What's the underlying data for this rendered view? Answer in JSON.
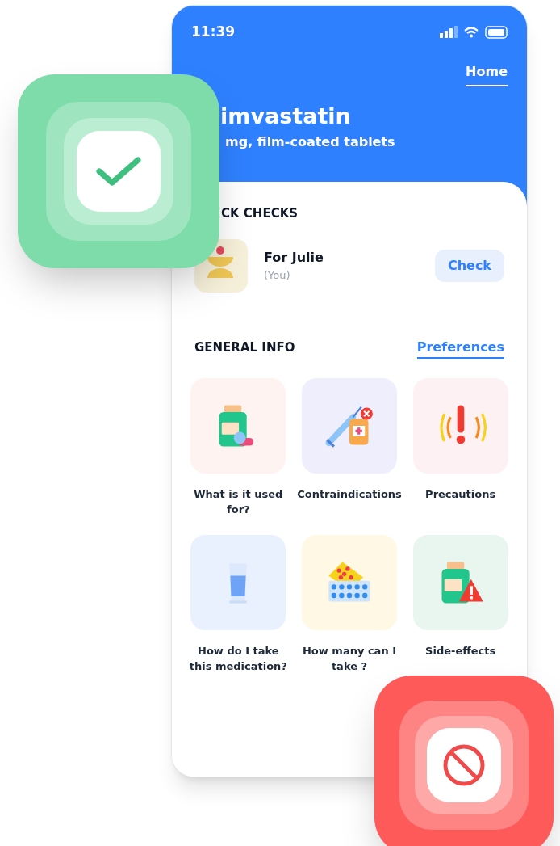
{
  "status_bar": {
    "time": "11:39"
  },
  "nav": {
    "label": "Home",
    "selected": true
  },
  "drug": {
    "name": "imvastatin",
    "description": "mg, film-coated tablets"
  },
  "quick_checks": {
    "heading": "CK CHECKS",
    "person": {
      "name": "For Julie",
      "note": "(You)"
    },
    "button": "Check"
  },
  "general_info": {
    "heading": "GENERAL INFO",
    "link": "Preferences",
    "tiles": [
      {
        "label": "What is it used for?",
        "kind": "bottle",
        "color": "#fef3f0"
      },
      {
        "label": "Contraindications",
        "kind": "syringe",
        "color": "#efeefd"
      },
      {
        "label": "Precautions",
        "kind": "alert",
        "color": "#fef1f3"
      },
      {
        "label": "How do I take this medication?",
        "kind": "glass",
        "color": "#e9f1fe"
      },
      {
        "label": "How many can I take ?",
        "kind": "blister",
        "color": "#fef8e4"
      },
      {
        "label": "Side-effects",
        "kind": "bottle-warning",
        "color": "#e8f6ef"
      }
    ]
  },
  "badges": [
    {
      "kind": "check",
      "color": "#7edcaa"
    },
    {
      "kind": "blocked",
      "color": "#fe5a5a"
    }
  ]
}
